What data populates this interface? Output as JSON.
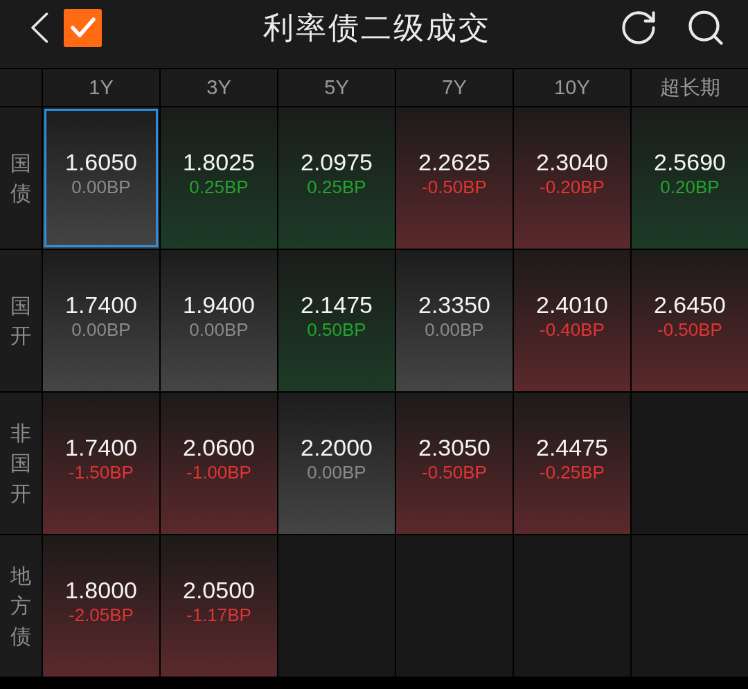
{
  "header": {
    "title": "利率债二级成交",
    "checkbox": {
      "checked": true
    }
  },
  "columns": [
    "1Y",
    "3Y",
    "5Y",
    "7Y",
    "10Y",
    "超长期"
  ],
  "rows": [
    {
      "label": "国债",
      "cells": [
        {
          "rate": "1.6050",
          "change": "0.00BP",
          "kind": "flat",
          "selected": true
        },
        {
          "rate": "1.8025",
          "change": "0.25BP",
          "kind": "rise",
          "selected": false
        },
        {
          "rate": "2.0975",
          "change": "0.25BP",
          "kind": "rise",
          "selected": false
        },
        {
          "rate": "2.2625",
          "change": "-0.50BP",
          "kind": "fall",
          "selected": false
        },
        {
          "rate": "2.3040",
          "change": "-0.20BP",
          "kind": "fall",
          "selected": false
        },
        {
          "rate": "2.5690",
          "change": "0.20BP",
          "kind": "rise",
          "selected": false
        }
      ]
    },
    {
      "label": "国开",
      "cells": [
        {
          "rate": "1.7400",
          "change": "0.00BP",
          "kind": "flat",
          "selected": false
        },
        {
          "rate": "1.9400",
          "change": "0.00BP",
          "kind": "flat",
          "selected": false
        },
        {
          "rate": "2.1475",
          "change": "0.50BP",
          "kind": "rise",
          "selected": false
        },
        {
          "rate": "2.3350",
          "change": "0.00BP",
          "kind": "flat",
          "selected": false
        },
        {
          "rate": "2.4010",
          "change": "-0.40BP",
          "kind": "fall",
          "selected": false
        },
        {
          "rate": "2.6450",
          "change": "-0.50BP",
          "kind": "fall",
          "selected": false
        }
      ]
    },
    {
      "label": "非国开",
      "cells": [
        {
          "rate": "1.7400",
          "change": "-1.50BP",
          "kind": "fall",
          "selected": false
        },
        {
          "rate": "2.0600",
          "change": "-1.00BP",
          "kind": "fall",
          "selected": false
        },
        {
          "rate": "2.2000",
          "change": "0.00BP",
          "kind": "flat",
          "selected": false
        },
        {
          "rate": "2.3050",
          "change": "-0.50BP",
          "kind": "fall",
          "selected": false
        },
        {
          "rate": "2.4475",
          "change": "-0.25BP",
          "kind": "fall",
          "selected": false
        }
      ]
    },
    {
      "label": "地方债",
      "cells": [
        {
          "rate": "1.8000",
          "change": "-2.05BP",
          "kind": "fall",
          "selected": false
        },
        {
          "rate": "2.0500",
          "change": "-1.17BP",
          "kind": "fall",
          "selected": false
        }
      ]
    }
  ]
}
